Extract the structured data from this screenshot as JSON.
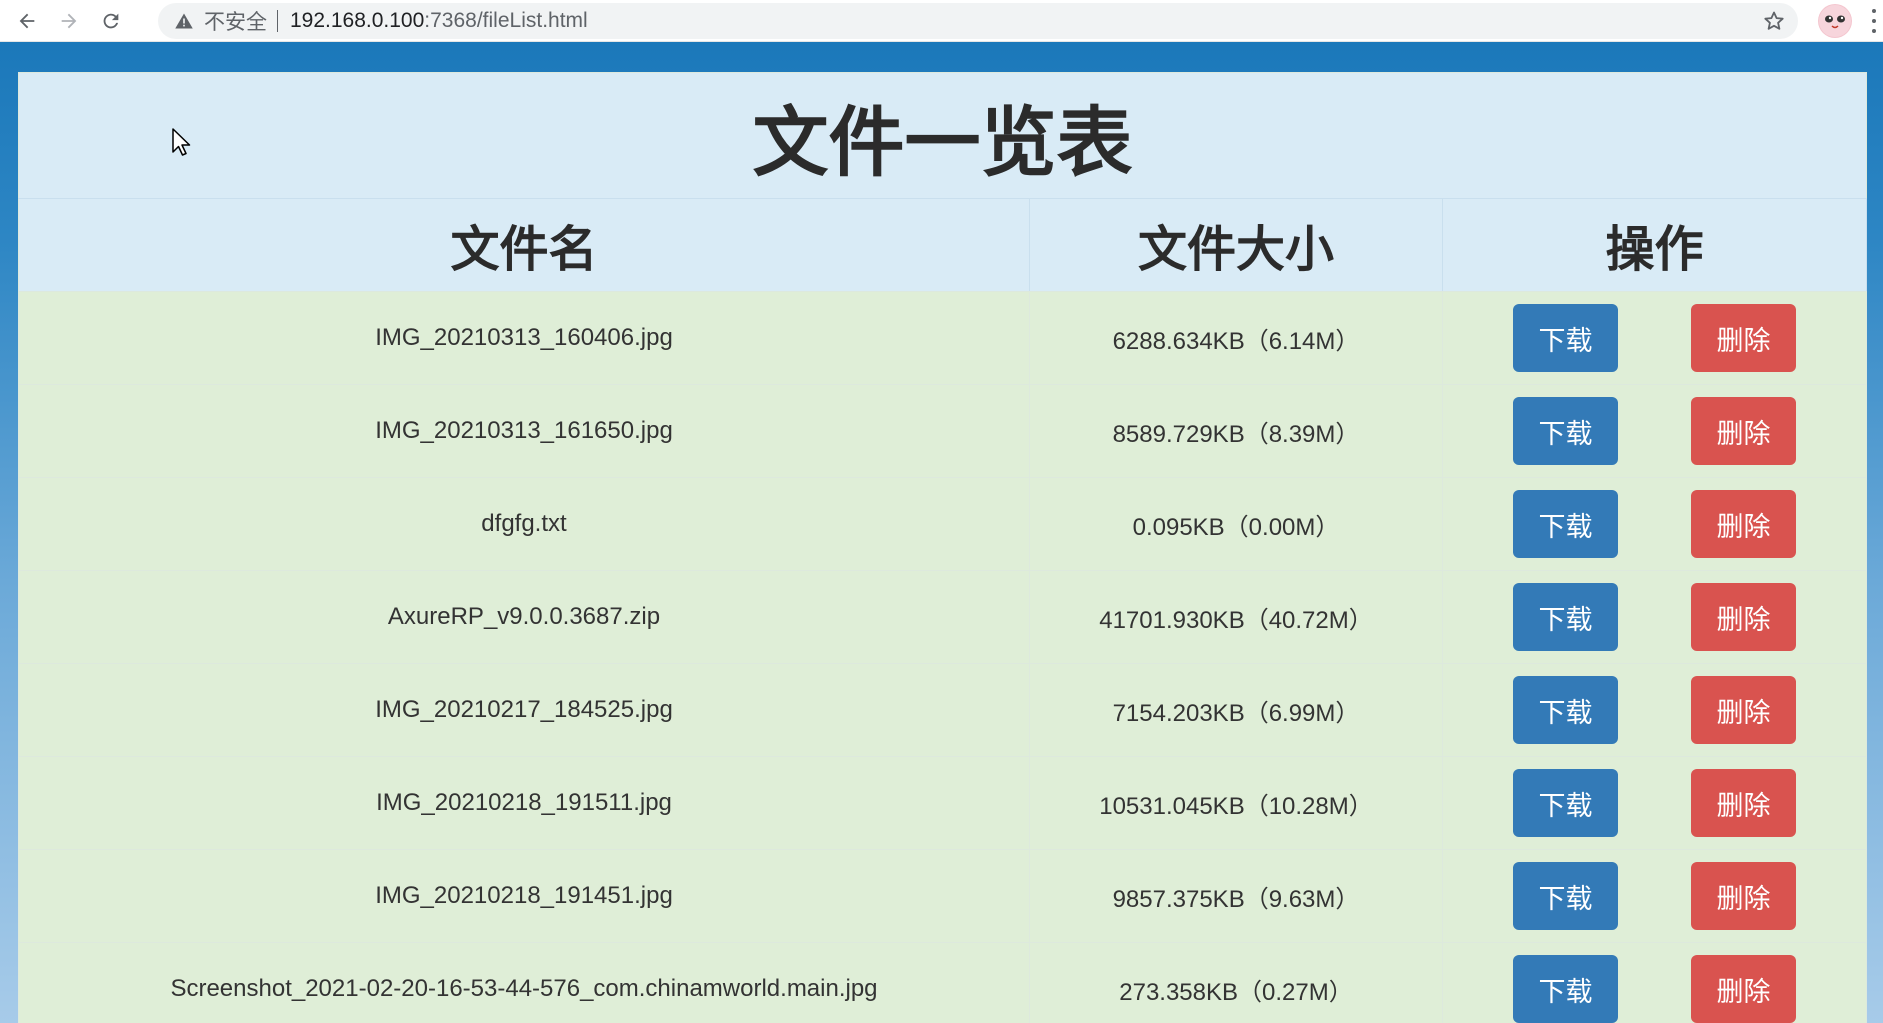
{
  "browser": {
    "security_label": "不安全",
    "url_host": "192.168.0.100",
    "url_path": ":7368/fileList.html"
  },
  "page": {
    "title": "文件一览表",
    "columns": [
      "文件名",
      "文件大小",
      "操作"
    ],
    "download_label": "下载",
    "delete_label": "删除",
    "files": [
      {
        "name": "IMG_20210313_160406.jpg",
        "size": "6288.634KB（6.14M）"
      },
      {
        "name": "IMG_20210313_161650.jpg",
        "size": "8589.729KB（8.39M）"
      },
      {
        "name": "dfgfg.txt",
        "size": "0.095KB（0.00M）"
      },
      {
        "name": "AxureRP_v9.0.0.3687.zip",
        "size": "41701.930KB（40.72M）"
      },
      {
        "name": "IMG_20210217_184525.jpg",
        "size": "7154.203KB（6.99M）"
      },
      {
        "name": "IMG_20210218_191511.jpg",
        "size": "10531.045KB（10.28M）"
      },
      {
        "name": "IMG_20210218_191451.jpg",
        "size": "9857.375KB（9.63M）"
      },
      {
        "name": "Screenshot_2021-02-20-16-53-44-576_com.chinamworld.main.jpg",
        "size": "273.358KB（0.27M）"
      }
    ]
  },
  "colors": {
    "download": "#337ab7",
    "delete": "#d9534f",
    "header_bg": "#d9ebf6",
    "row_bg": "#dfeed7"
  }
}
